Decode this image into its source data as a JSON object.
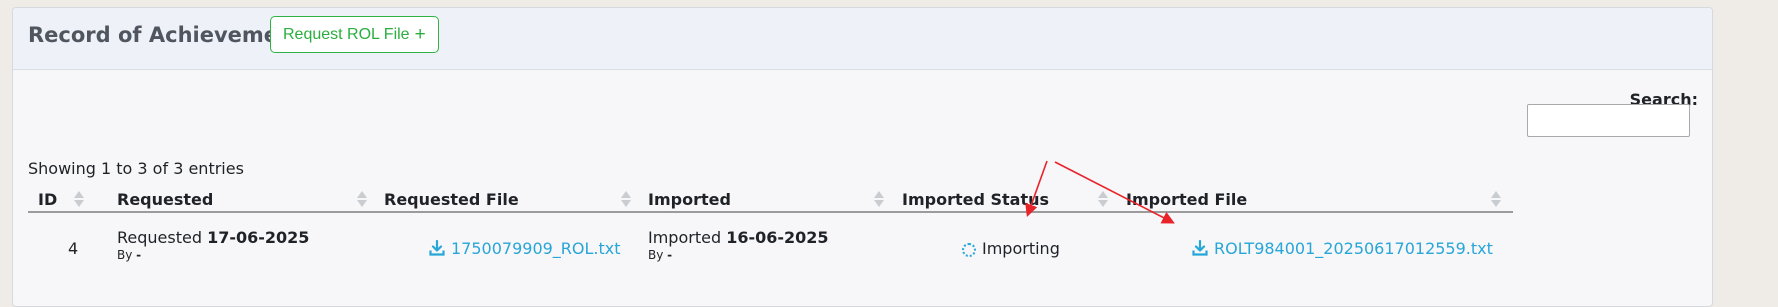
{
  "header": {
    "title": "Record of Achievement",
    "request_button_label": "Request ROL File"
  },
  "search": {
    "label": "Search:",
    "value": ""
  },
  "table_info": "Showing 1 to 3 of 3 entries",
  "columns": [
    "ID",
    "Requested",
    "Requested File",
    "Imported",
    "Imported Status",
    "Imported File"
  ],
  "rows": [
    {
      "id": "4",
      "requested_prefix": "Requested",
      "requested_date": "17-06-2025",
      "requested_by_label": "By",
      "requested_by": "-",
      "requested_file": "1750079909_ROL.txt",
      "imported_prefix": "Imported",
      "imported_date": "16-06-2025",
      "imported_by_label": "By",
      "imported_by": "-",
      "imported_status": "Importing",
      "imported_file": "ROLT984001_20250617012559.txt"
    }
  ],
  "colors": {
    "accent_green": "#2bae3f",
    "link_blue": "#27a6d8",
    "annotation_red": "#e8232a"
  }
}
